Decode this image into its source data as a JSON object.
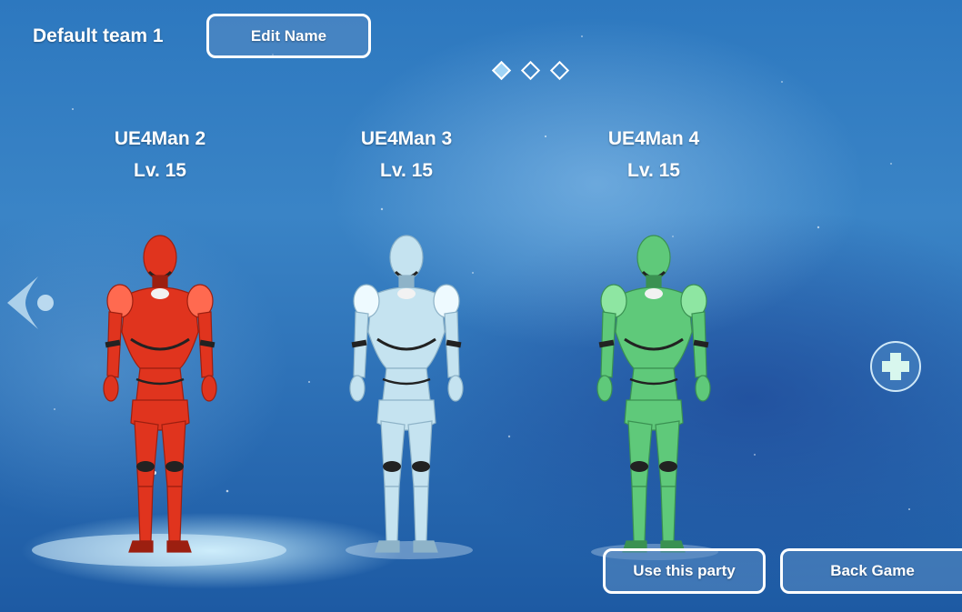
{
  "header": {
    "team_name": "Default team 1",
    "edit_label": "Edit Name"
  },
  "pager": {
    "pages": 3,
    "active_index": 0
  },
  "members": [
    {
      "name": "UE4Man 2",
      "level": "Lv. 15",
      "color": "#e0341e",
      "shade": "#9c1f10",
      "accent": "#ff6a50"
    },
    {
      "name": "UE4Man 3",
      "level": "Lv. 15",
      "color": "#c5e3f0",
      "shade": "#8eb3c8",
      "accent": "#eefaff"
    },
    {
      "name": "UE4Man 4",
      "level": "Lv. 15",
      "color": "#5fc97a",
      "shade": "#3a9152",
      "accent": "#8ee6a2"
    }
  ],
  "nav": {
    "prev_icon": "arrow-left-icon",
    "add_icon": "plus-icon"
  },
  "footer": {
    "use_label": "Use this party",
    "back_label": "Back Game"
  },
  "colors": {
    "button_border": "#ffffff",
    "active_dot": "#9fd3f5",
    "background": "#2d78bf"
  }
}
